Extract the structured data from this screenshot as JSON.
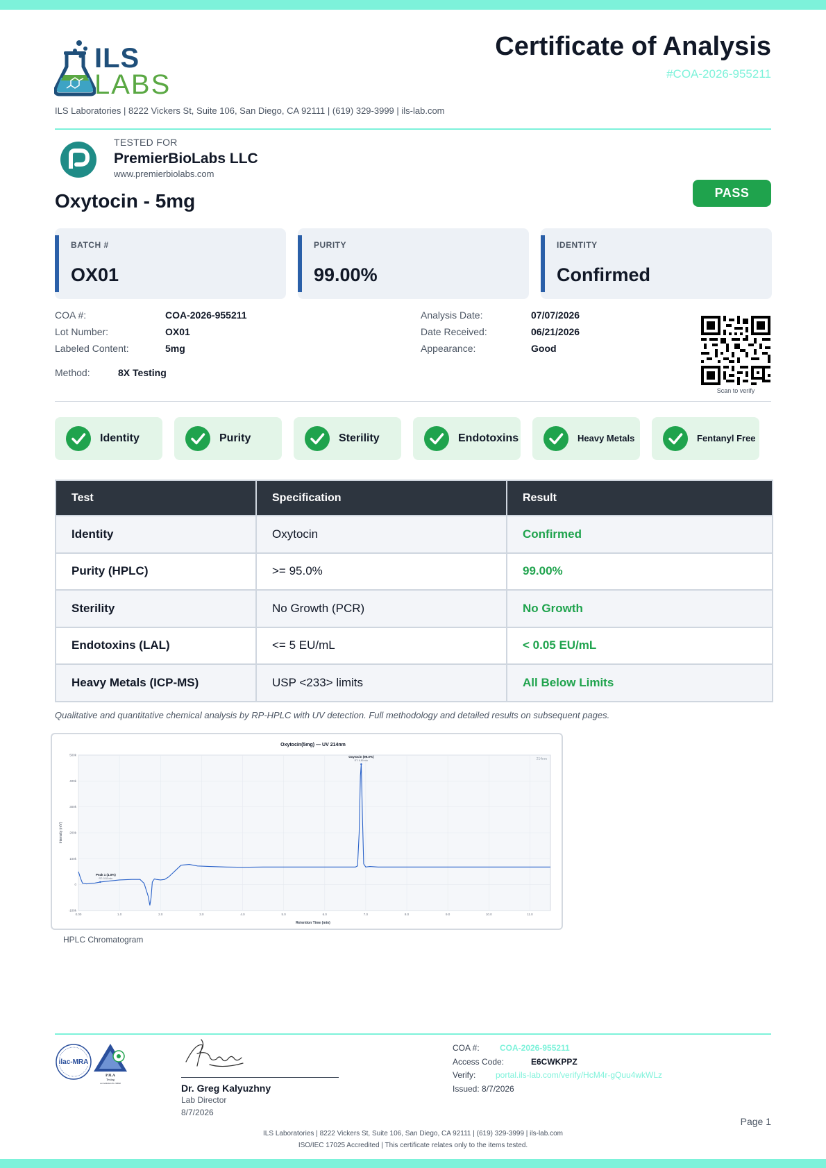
{
  "header": {
    "logo_top": "ILS",
    "logo_bottom": "LABS",
    "title": "Certificate of Analysis",
    "coa_number": "#COA-2026-955211",
    "address": "ILS Laboratories  |  8222 Vickers St, Suite 106, San Diego, CA 92111  |  (619) 329-3999  |  ils-lab.com"
  },
  "client": {
    "tested_for_label": "TESTED FOR",
    "name": "PremierBioLabs LLC",
    "url": "www.premierbiolabs.com"
  },
  "product": {
    "name": "Oxytocin - 5mg",
    "status": "PASS"
  },
  "summary": [
    {
      "label": "BATCH #",
      "value": "OX01"
    },
    {
      "label": "PURITY",
      "value": "99.00%"
    },
    {
      "label": "IDENTITY",
      "value": "Confirmed"
    }
  ],
  "details": {
    "coa_label": "COA #:",
    "coa_value": "COA-2026-955211",
    "lot_label": "Lot Number:",
    "lot_value": "OX01",
    "content_label": "Labeled Content:",
    "content_value": "5mg",
    "method_label": "Method:",
    "method_value": "8X Testing",
    "analysis_label": "Analysis Date:",
    "analysis_value": "07/07/2026",
    "received_label": "Date Received:",
    "received_value": "06/21/2026",
    "appearance_label": "Appearance:",
    "appearance_value": "Good",
    "qr_caption": "Scan to verify"
  },
  "checks": [
    "Identity",
    "Purity",
    "Sterility",
    "Endotoxins",
    "Heavy Metals",
    "Fentanyl Free"
  ],
  "results_table": {
    "headers": [
      "Test",
      "Specification",
      "Result"
    ],
    "rows": [
      [
        "Identity",
        "Oxytocin",
        "Confirmed"
      ],
      [
        "Purity (HPLC)",
        ">= 95.0%",
        "99.00%"
      ],
      [
        "Sterility",
        "No Growth (PCR)",
        "No Growth"
      ],
      [
        "Endotoxins (LAL)",
        "<= 5 EU/mL",
        "< 0.05 EU/mL"
      ],
      [
        "Heavy Metals (ICP-MS)",
        "USP <233> limits",
        "All Below Limits"
      ]
    ]
  },
  "method_note": "Qualitative and quantitative chemical analysis by RP-HPLC with UV detection. Full methodology and detailed results on subsequent pages.",
  "chart_data": {
    "type": "line",
    "title": "Oxytocin(5mg) — UV 214nm",
    "xlabel": "Retention Time (min)",
    "ylabel": "Intensity (mV)",
    "corner_label": "214nm",
    "xlim": [
      0,
      11.5
    ],
    "ylim": [
      -100,
      500
    ],
    "x_ticks": [
      "0.00",
      "1.0",
      "2.0",
      "3.0",
      "4.0",
      "5.0",
      "6.0",
      "7.0",
      "8.0",
      "9.0",
      "10.0",
      "11.0"
    ],
    "x_tick_values": [
      0,
      1,
      2,
      3,
      4,
      5,
      6,
      7,
      8,
      9,
      10,
      11
    ],
    "y_ticks": [
      "500k",
      "400k",
      "300k",
      "200k",
      "100k",
      "0",
      "-100k"
    ],
    "y_tick_values": [
      500,
      400,
      300,
      200,
      100,
      0,
      -100
    ],
    "annotations": [
      {
        "label": "Oxytocin (99.0%)",
        "sublabel": "RT: 6.89 min",
        "x": 6.89,
        "y": 465
      },
      {
        "label": "Peak 1 (1.0%)",
        "sublabel": "RT: 0.53 min",
        "x": 0.53,
        "y": 10
      }
    ],
    "x": [
      0,
      0.05,
      0.1,
      0.2,
      0.4,
      0.53,
      0.7,
      1.0,
      1.3,
      1.5,
      1.6,
      1.7,
      1.74,
      1.77,
      1.8,
      1.85,
      1.9,
      2.0,
      2.1,
      2.2,
      2.3,
      2.5,
      2.7,
      2.9,
      3.2,
      3.6,
      4.0,
      4.5,
      5.0,
      5.5,
      6.0,
      6.5,
      6.75,
      6.8,
      6.84,
      6.87,
      6.89,
      6.92,
      6.95,
      7.0,
      7.1,
      7.3,
      7.6,
      8.0,
      9.0,
      10.0,
      11.0,
      11.5
    ],
    "y": [
      50,
      25,
      5,
      3,
      6,
      10,
      13,
      18,
      20,
      20,
      5,
      -45,
      -80,
      -50,
      10,
      22,
      20,
      18,
      20,
      30,
      45,
      75,
      78,
      72,
      70,
      68,
      67,
      68,
      68,
      68,
      68,
      68,
      68,
      72,
      200,
      420,
      465,
      260,
      80,
      68,
      70,
      68,
      68,
      68,
      68,
      68,
      68,
      68
    ]
  },
  "chart_caption": "HPLC Chromatogram",
  "footer": {
    "signer_name": "Dr. Greg Kalyuzhny",
    "signer_title": "Lab Director",
    "signer_date": "8/7/2026",
    "coa_label": "COA #:",
    "coa_value": "COA-2026-955211",
    "access_label": "Access Code:",
    "access_value": "E6CWKPPZ",
    "verify_label": "Verify:",
    "verify_value": "portal.ils-lab.com/verify/HcM4r-gQuu4wkWLz",
    "issued": "Issued: 8/7/2026",
    "page": "Page 1",
    "line1": "ILS Laboratories  |  8222 Vickers St, Suite 106, San Diego, CA 92111  |  (619) 329-3999  |  ils-lab.com",
    "line2": "ISO/IEC 17025 Accredited  |  This certificate relates only to the items tested.",
    "seal1": "ilac-MRA",
    "seal2": "PJLA",
    "seal2_sub": "Testing",
    "seal2_acc": "Accreditation No. 99662"
  },
  "colors": {
    "teal": "#7df2da",
    "navy": "#2d353f",
    "pass_green": "#1fa34d",
    "card_accent": "#2a5fa8",
    "chart_line": "#2a62c9"
  }
}
